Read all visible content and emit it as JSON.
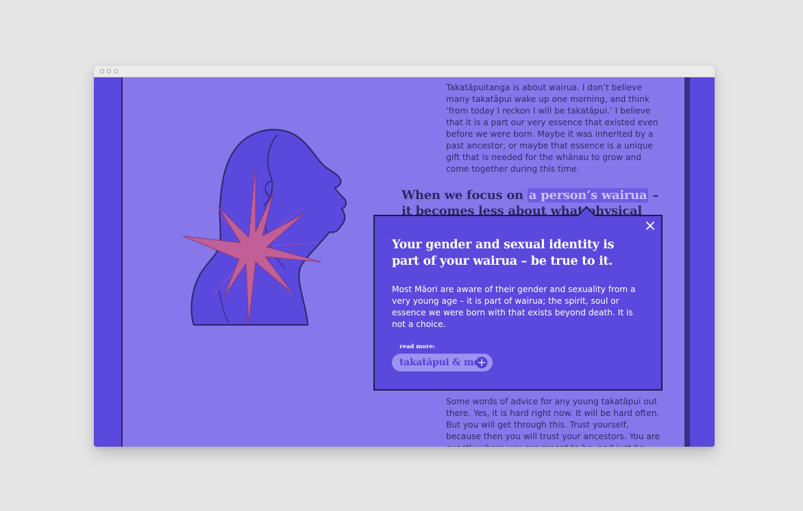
{
  "colors": {
    "page_background": "#8678ea",
    "rail": "#5b48dc",
    "popup_background": "#5b48dc",
    "text_dark": "#2f2a66",
    "highlight": "#6d5ce3",
    "starburst": "#c25f97"
  },
  "article": {
    "paragraph_top": "Takatāpuitanga is about wairua. I don’t believe many takatāpui wake up one morning, and think ‘from today I reckon I will be takatāpui.’ I believe that it is a part our very essence that existed even before we were born. Maybe it was inherited by a past ancestor, or maybe that essence is a unique gift that is needed for the whānau to grow and come together during this time.",
    "pull_quote_before": "When we focus on ",
    "pull_quote_highlight": "a person’s wairua",
    "pull_quote_after": " – it becomes less about what physical body",
    "paragraph_bottom": "Some words of advice for any young takatāpui out there. Yes, it is hard right now. It will be hard often. But you will get through this. Trust yourself, because then you will trust your ancestors. You are exactly where you are meant to be, and just be brave."
  },
  "popup": {
    "title": "Your gender and sexual identity is part of your wairua – be true to it.",
    "body": "Most Māori are aware of their gender and sexuality from a very young age – it is part of wairua; the spirit, soul or essence we were born with that exists beyond death. It is not a choice.",
    "read_more_label": "read more:",
    "read_more_link": "takatāpui & me",
    "close_icon": "close-icon",
    "link_icon": "plus-circle-icon"
  }
}
